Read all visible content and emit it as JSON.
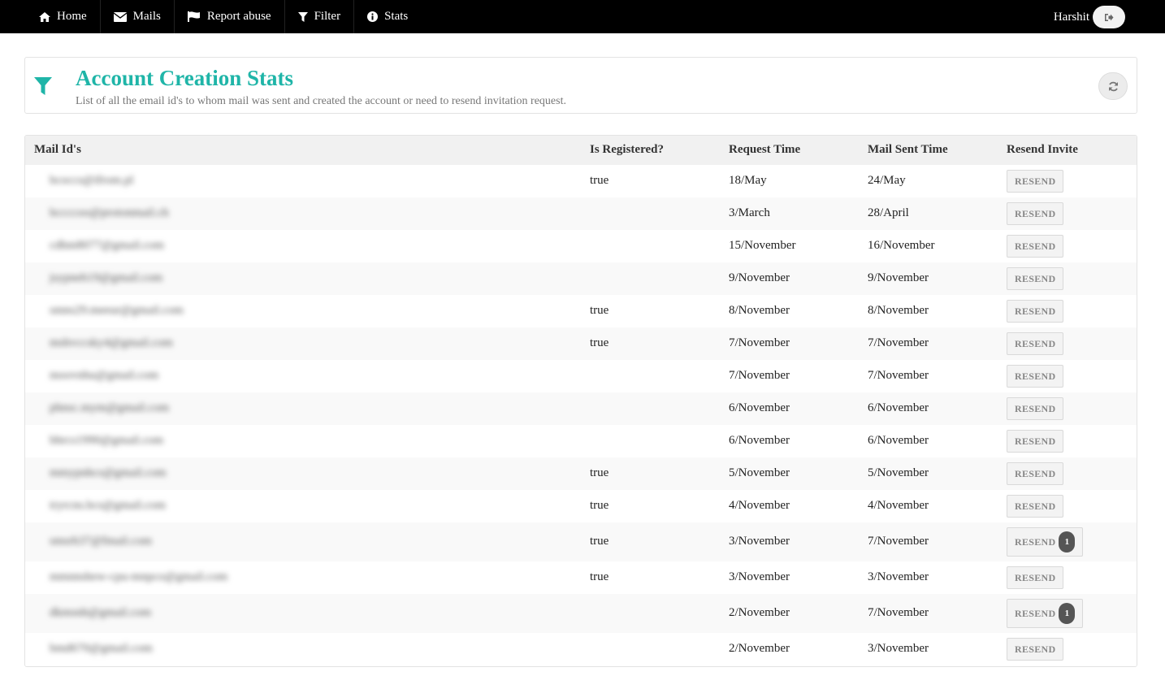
{
  "navbar": {
    "items": [
      {
        "label": "Home",
        "icon": "home-icon"
      },
      {
        "label": "Mails",
        "icon": "envelope-icon"
      },
      {
        "label": "Report abuse",
        "icon": "flag-icon"
      },
      {
        "label": "Filter",
        "icon": "filter-icon"
      },
      {
        "label": "Stats",
        "icon": "info-icon"
      }
    ],
    "user_name": "Harshit",
    "logout_icon": "sign-out-icon"
  },
  "header": {
    "title": "Account Creation Stats",
    "subtitle": "List of all the email id's to whom mail was sent and created the account or need to resend invitation request.",
    "icon": "filter-icon",
    "refresh_icon": "refresh-icon",
    "accent_color": "#1fb5a8"
  },
  "table": {
    "columns": [
      "Mail Id's",
      "Is Registered?",
      "Request Time",
      "Mail Sent Time",
      "Resend Invite"
    ],
    "rows": [
      {
        "email": "bcoccs@ifrom.pl",
        "registered": "true",
        "request_time": "18/May",
        "sent_time": "24/May",
        "resend_label": "RESEND",
        "badge": ""
      },
      {
        "email": "bccccoo@protonmail.ch",
        "registered": "",
        "request_time": "3/March",
        "sent_time": "28/April",
        "resend_label": "RESEND",
        "badge": ""
      },
      {
        "email": "cdhm8077@gmail.com",
        "registered": "",
        "request_time": "15/November",
        "sent_time": "16/November",
        "resend_label": "RESEND",
        "badge": ""
      },
      {
        "email": "jsypneh19@gmail.com",
        "registered": "",
        "request_time": "9/November",
        "sent_time": "9/November",
        "resend_label": "RESEND",
        "badge": ""
      },
      {
        "email": "smns29.meeur@gmail.com",
        "registered": "true",
        "request_time": "8/November",
        "sent_time": "8/November",
        "resend_label": "RESEND",
        "badge": ""
      },
      {
        "email": "mshvccsky4@gmail.com",
        "registered": "true",
        "request_time": "7/November",
        "sent_time": "7/November",
        "resend_label": "RESEND",
        "badge": ""
      },
      {
        "email": "moovnhu@gmail.com",
        "registered": "",
        "request_time": "7/November",
        "sent_time": "7/November",
        "resend_label": "RESEND",
        "badge": ""
      },
      {
        "email": "phnsc.mym@gmail.com",
        "registered": "",
        "request_time": "6/November",
        "sent_time": "6/November",
        "resend_label": "RESEND",
        "badge": ""
      },
      {
        "email": "bhrcs1990@gmail.com",
        "registered": "",
        "request_time": "6/November",
        "sent_time": "6/November",
        "resend_label": "RESEND",
        "badge": ""
      },
      {
        "email": "mmypnhcs@gmail.com",
        "registered": "true",
        "request_time": "5/November",
        "sent_time": "5/November",
        "resend_label": "RESEND",
        "badge": ""
      },
      {
        "email": "tryrcns.bcs@gmail.com",
        "registered": "true",
        "request_time": "4/November",
        "sent_time": "4/November",
        "resend_label": "RESEND",
        "badge": ""
      },
      {
        "email": "smsrh37@fmail.com",
        "registered": "true",
        "request_time": "3/November",
        "sent_time": "7/November",
        "resend_label": "RESEND",
        "badge": "1"
      },
      {
        "email": "mmnnshew-cpu-mnpco@gmail.com",
        "registered": "true",
        "request_time": "3/November",
        "sent_time": "3/November",
        "resend_label": "RESEND",
        "badge": ""
      },
      {
        "email": "dkmsnh@gmail.com",
        "registered": "",
        "request_time": "2/November",
        "sent_time": "7/November",
        "resend_label": "RESEND",
        "badge": "1"
      },
      {
        "email": "bmd670@gmail.com",
        "registered": "",
        "request_time": "2/November",
        "sent_time": "3/November",
        "resend_label": "RESEND",
        "badge": ""
      }
    ]
  }
}
